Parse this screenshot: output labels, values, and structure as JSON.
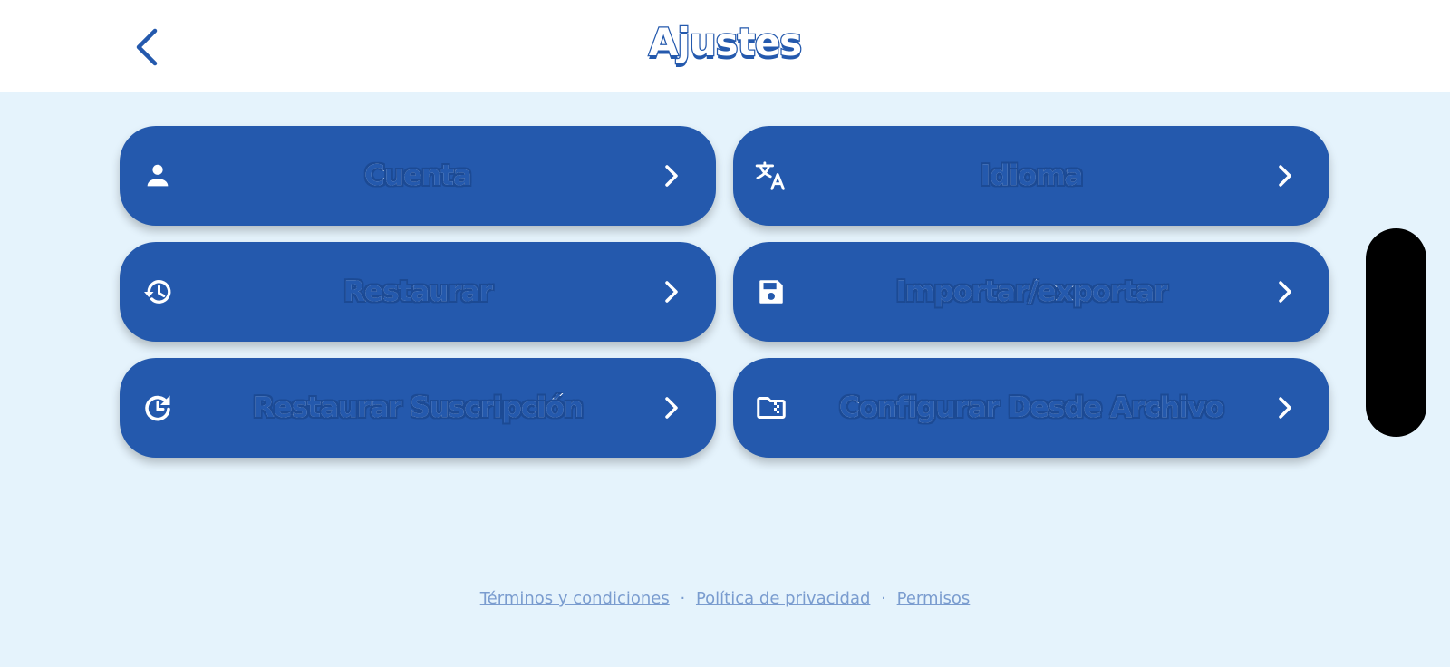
{
  "header": {
    "title": "Ajustes"
  },
  "settings": {
    "items": [
      {
        "label": "Cuenta",
        "icon": "person-icon"
      },
      {
        "label": "Idioma",
        "icon": "translate-icon"
      },
      {
        "label": "Restaurar",
        "icon": "history-icon"
      },
      {
        "label": "Importar/exportar",
        "icon": "save-icon"
      },
      {
        "label": "Restaurar Suscripción",
        "icon": "restore-icon"
      },
      {
        "label": "Configurar Desde Archivo",
        "icon": "folder-zip-icon"
      }
    ]
  },
  "footer": {
    "terms": "Términos y condiciones",
    "privacy": "Política de privacidad",
    "permissions": "Permisos",
    "separator": "·"
  },
  "colors": {
    "accent": "#2459ad",
    "background": "#e5f3fc",
    "link": "#7a9ccf"
  }
}
